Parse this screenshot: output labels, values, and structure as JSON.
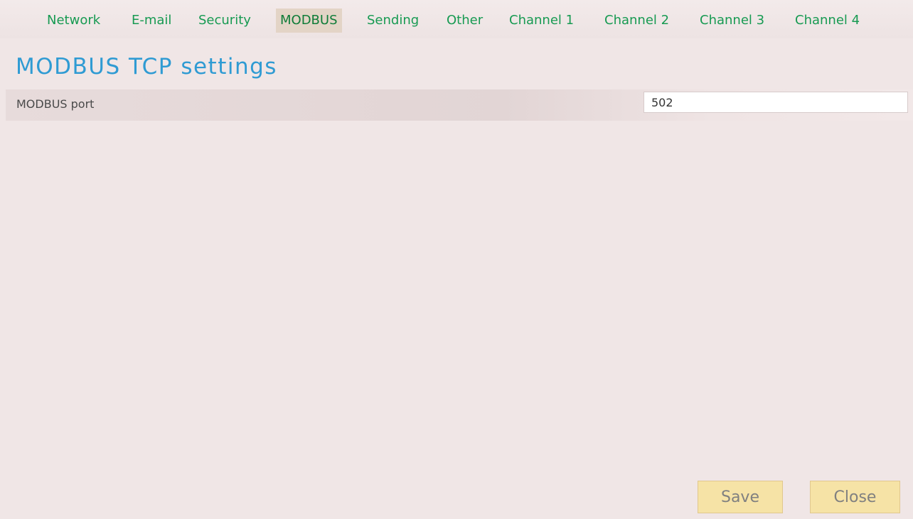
{
  "tabs": [
    {
      "label": "Network"
    },
    {
      "label": "E-mail"
    },
    {
      "label": "Security"
    },
    {
      "label": "MODBUS",
      "active": true
    },
    {
      "label": "Sending"
    },
    {
      "label": "Other"
    },
    {
      "label": "Channel 1"
    },
    {
      "label": "Channel 2"
    },
    {
      "label": "Channel 3"
    },
    {
      "label": "Channel 4"
    }
  ],
  "page": {
    "title": "MODBUS TCP settings"
  },
  "settings": {
    "modbus_port": {
      "label": "MODBUS port",
      "value": "502"
    }
  },
  "actions": {
    "save_label": "Save",
    "close_label": "Close"
  },
  "colors": {
    "tab_text": "#179a52",
    "tab_active_bg": "#e3d4c6",
    "title": "#2f9bd3",
    "button_bg": "#f6e3a6",
    "background": "#f0e6e6"
  }
}
